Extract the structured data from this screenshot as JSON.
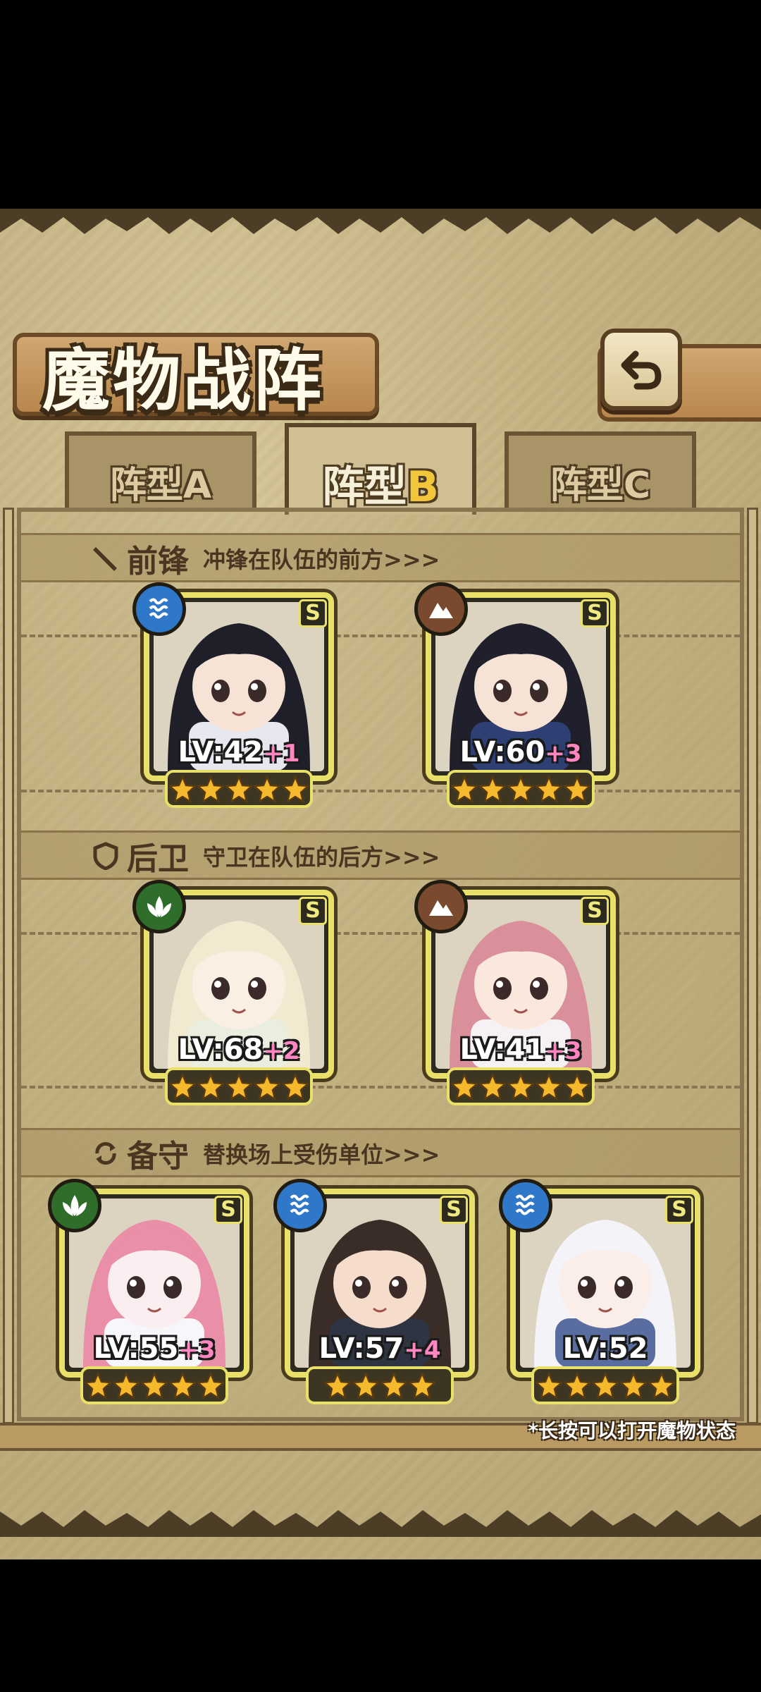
{
  "title": "魔物战阵",
  "tabs": [
    {
      "label": "阵型A",
      "main": "阵型",
      "letter": "A",
      "active": false
    },
    {
      "label": "阵型B",
      "main": "阵型",
      "letter": "B",
      "active": true
    },
    {
      "label": "阵型C",
      "main": "阵型",
      "letter": "C",
      "active": false
    }
  ],
  "sections": {
    "front": {
      "title": "前锋",
      "subtitle": "冲锋在队伍的前方>>>",
      "icon": "sword-icon"
    },
    "rear": {
      "title": "后卫",
      "subtitle": "守卫在队伍的后方>>>",
      "icon": "shield-icon"
    },
    "reserve": {
      "title": "备守",
      "subtitle": "替换场上受伤单位>>>",
      "icon": "swap-icon"
    }
  },
  "units": {
    "front": [
      {
        "level": "LV:42",
        "bonus": "+1",
        "rank": "S",
        "element": "water",
        "stars": 5,
        "hair": "#1f1f2a",
        "skin": "#f7e2d6",
        "cloth": "#e7e7ef"
      },
      {
        "level": "LV:60",
        "bonus": "+3",
        "rank": "S",
        "element": "earth",
        "stars": 5,
        "hair": "#20202c",
        "skin": "#f7e2d6",
        "cloth": "#2e3f74"
      }
    ],
    "rear": [
      {
        "level": "LV:68",
        "bonus": "+2",
        "rank": "S",
        "element": "wind",
        "stars": 5,
        "hair": "#f2ead0",
        "skin": "#fbefe4",
        "cloth": "#e9eedf"
      },
      {
        "level": "LV:41",
        "bonus": "+3",
        "rank": "S",
        "element": "earth",
        "stars": 5,
        "hair": "#d9909a",
        "skin": "#fbe8dc",
        "cloth": "#f6f1f4"
      }
    ],
    "reserve": [
      {
        "level": "LV:55",
        "bonus": "+3",
        "rank": "S",
        "element": "wind",
        "stars": 5,
        "hair": "#e98fa8",
        "skin": "#fbeef0",
        "cloth": "#f7f7fb"
      },
      {
        "level": "LV:57",
        "bonus": "+4",
        "rank": "S",
        "element": "water",
        "stars": 4,
        "hair": "#3a2c27",
        "skin": "#f6dccb",
        "cloth": "#2f3442"
      },
      {
        "level": "LV:52",
        "bonus": "",
        "rank": "S",
        "element": "water",
        "stars": 5,
        "hair": "#f3f3f8",
        "skin": "#fbeee8",
        "cloth": "#5a6da0"
      }
    ]
  },
  "footnote": "*长按可以打开魔物状态",
  "colors": {
    "water": "#2f77c9",
    "earth": "#7a4a2e",
    "wind": "#2f6e2a",
    "frame": "#e9e06a",
    "star": "#f5b92e",
    "bonus": "#ff86c0"
  }
}
